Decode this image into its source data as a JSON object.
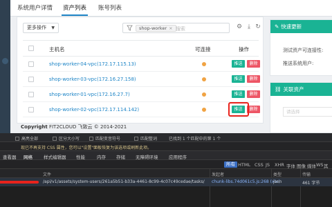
{
  "tabs": [
    {
      "label": "系统用户详情"
    },
    {
      "label": "资产列表"
    },
    {
      "label": "账号列表"
    }
  ],
  "toolbar": {
    "more_label": "更多操作",
    "filter_tag": "shop-worker",
    "filter_placeholder": "搜索"
  },
  "table": {
    "headers": {
      "host": "主机名",
      "reachable": "可连接",
      "actions": "操作"
    },
    "rows": [
      {
        "host": "shop-worker-04-vpc(172.17.115.13)"
      },
      {
        "host": "shop-worker-03-vpc(172.16.27.158)"
      },
      {
        "host": "shop-worker-01-vpc(172.16.27.7)"
      },
      {
        "host": "shop-worker-02-vpc(172.17.114.142)"
      }
    ],
    "push_label": "推送",
    "delete_label": "删除"
  },
  "copyright": {
    "brand": "Copyright",
    "text": "FIT2CLOUD 飞致云 © 2014-2021"
  },
  "quick_update": {
    "title": "快速更新",
    "test_label": "测试资产可连接性:",
    "push_label": "推送系统用户:"
  },
  "related": {
    "title": "关联资产",
    "placeholder": "请选择"
  },
  "devtools": {
    "options": [
      "高亮全部",
      "区分大小写",
      "匹配变音符号",
      "匹配整词",
      "已找到 1 个匹配中的第 1 个"
    ],
    "warning": "现已不再支持 CSS 属性，您可以\"设置\"面板恢复为该选项或刷新此项。",
    "panels": [
      "查看器",
      "网络",
      "样式编辑器",
      "性能",
      "内存",
      "存储",
      "无障碍环境",
      "应用程序"
    ],
    "filters": [
      "所有",
      "HTML",
      "CSS",
      "JS",
      "XHR",
      "字体",
      "图像",
      "媒体",
      "WS",
      "其他"
    ],
    "columns": {
      "file": "文件",
      "initiator": "发起者",
      "type": "类型",
      "size": "传输"
    },
    "request": {
      "file": "/api/v1/assets/system-users/261a5b51-b33a-4461-8c99-4c07c49cedae/tasks/",
      "initiator": "chunk-libs.74d061c5.js:268 (xhr)",
      "type": "json",
      "size": "461 字节"
    }
  },
  "colors": {
    "accent": "#1c84c6",
    "push": "#1ab394",
    "delete": "#ed5565",
    "highlight": "#e8231c",
    "status": "#f0a343"
  }
}
